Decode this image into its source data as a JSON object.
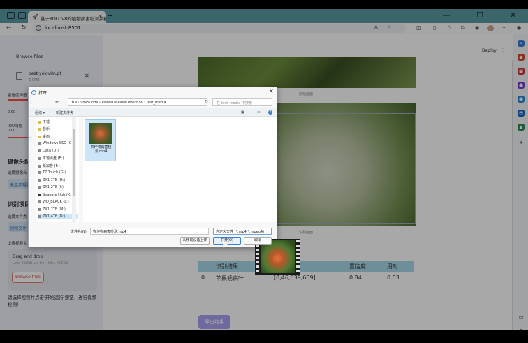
{
  "browser": {
    "tab_title": "基于YOLOv8的植物病害检测系统",
    "url": "localhost:8501"
  },
  "sidebar": {
    "browse_label": "Browse files",
    "file_name": "best-yolov8n.pt",
    "file_size": "6.0MB",
    "conf_label": "置信度阈值",
    "conf_value": "0.00",
    "iou_label": "IOU阈值",
    "iou_value": "0.00",
    "camera_header": "摄像头配",
    "camera_label": "选择摄像头",
    "camera_value": "未启用摄像",
    "recog_header": "识别项目",
    "type_label": "选择文件类",
    "type_value": "视频文件",
    "upload_label": "上传视频文",
    "drag_text": "Drag and drop",
    "limit_text": "Limit 200MB per file • MP4, MPEG4",
    "browse_btn": "Browse files",
    "hint": "请选择视频并点击'开始运行'按钮，进行视频检测!"
  },
  "main": {
    "deploy": "Deploy",
    "cap1": "原始画面",
    "cap2": "识别画面",
    "table": {
      "headers": [
        "识别结果",
        "位置",
        "置信度",
        "用时"
      ],
      "row": {
        "idx": "0",
        "result": "苹果锈病叶",
        "pos": "[0,46,639,609]",
        "conf": "0.84",
        "time": "0.03"
      }
    },
    "export_btn": "导出结果"
  },
  "dialog": {
    "title": "打开",
    "path": "YOLOv8v5Code  ›  PlantsDiseaseDetection  ›  test_media",
    "search_placeholder": "在 test_media 中搜索",
    "organize": "组织 ▾",
    "new_folder": "新建文件夹",
    "nav_items": [
      "下载",
      "音乐",
      "桌面",
      "Windows SSD (C",
      "Data (D:)",
      "本地磁盘 (E:)",
      "新加卷 (F:)",
      "T7 Touch (G:)",
      "ZX1 1TB (H:)",
      "ZX1 2TB (I:)",
      "Seagate Hub (K:",
      "WD_BLACK (L:)",
      "ZX1 2TB (M:)",
      "ZX1 4TB (N:)"
    ],
    "file_name": "农作物病害检测.mp4",
    "fn_label": "文件名(N):",
    "fn_value": "农作物病害检测.mp4",
    "filetype": "自定义文件 (*.mp4;*.mpeg4)",
    "btn_mobile": "从移动设备上传",
    "btn_open": "打开(O)",
    "btn_cancel": "取消"
  },
  "colors": {
    "tabbar": "#5a9aa2",
    "accent_red": "#ff4b4b",
    "export": "#a7a1f0",
    "table_head": "#a8d8e8"
  }
}
